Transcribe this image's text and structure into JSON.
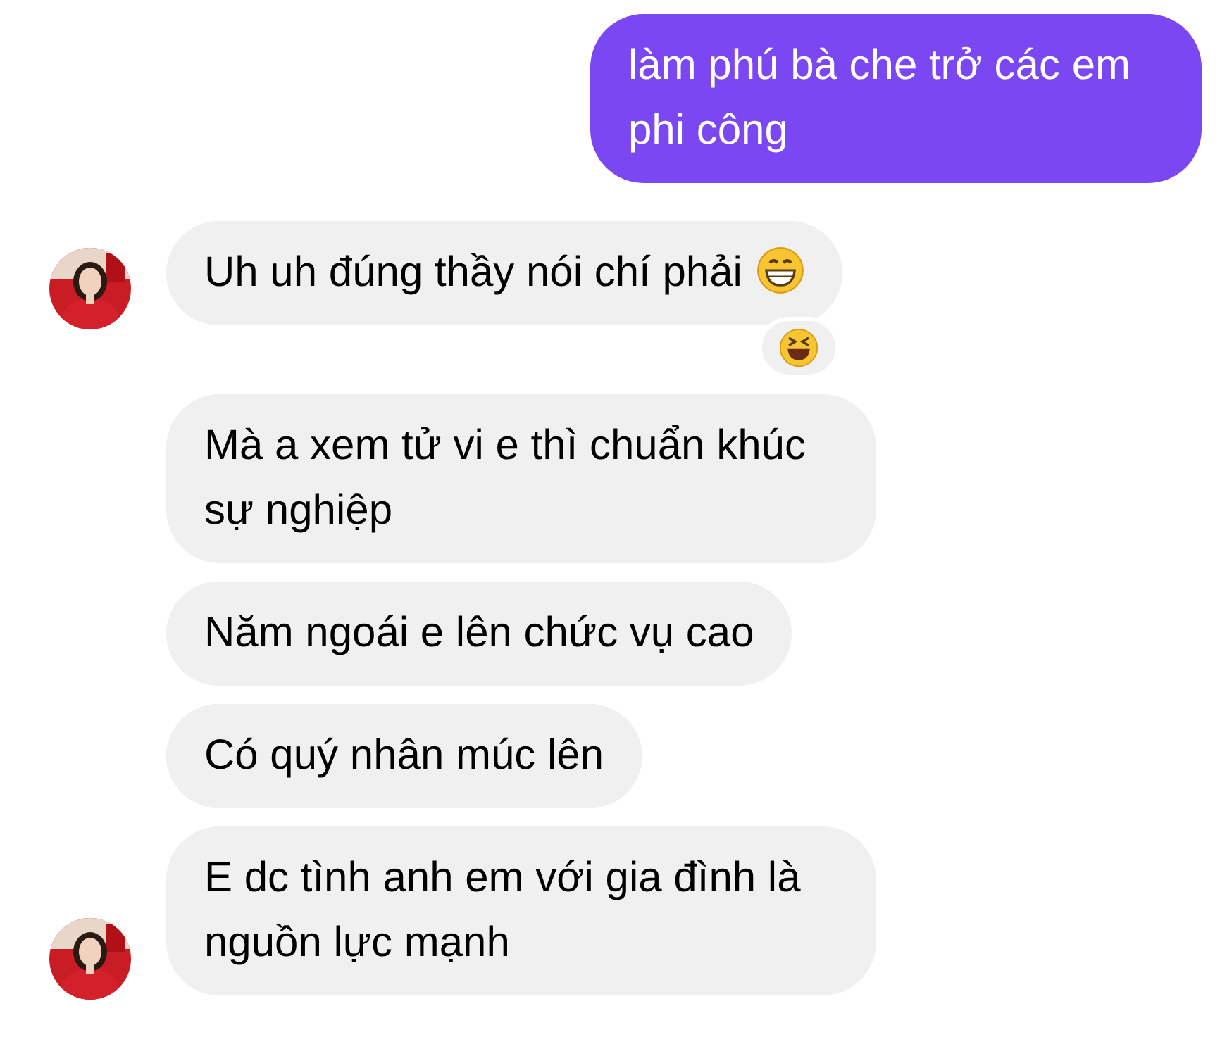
{
  "messages": [
    {
      "kind": "sent",
      "text": "làm phú bà che trở các em phi công",
      "show_avatar": false,
      "trailing_emoji": false,
      "reacted": false
    },
    {
      "kind": "received",
      "text": "Uh uh đúng thầy nói chí phải",
      "show_avatar": true,
      "trailing_emoji": true,
      "reacted": true
    },
    {
      "kind": "received",
      "text": "Mà a xem tử vi e thì chuẩn khúc sự nghiệp",
      "show_avatar": false,
      "trailing_emoji": false,
      "reacted": false
    },
    {
      "kind": "received",
      "text": "Năm ngoái e lên chức vụ cao",
      "show_avatar": false,
      "trailing_emoji": false,
      "reacted": false
    },
    {
      "kind": "received",
      "text": "Có quý nhân múc lên",
      "show_avatar": false,
      "trailing_emoji": false,
      "reacted": false
    },
    {
      "kind": "received",
      "text": "E dc tình anh em với gia đình là nguồn lực mạnh",
      "show_avatar": true,
      "trailing_emoji": false,
      "reacted": false
    }
  ]
}
